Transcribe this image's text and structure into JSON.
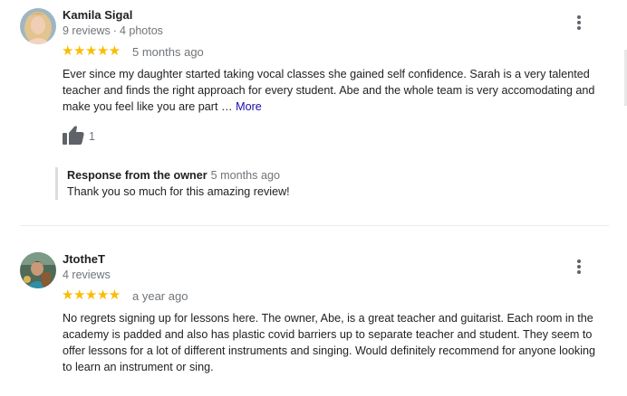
{
  "reviews": [
    {
      "author": "Kamila Sigal",
      "reviews_count": "9 reviews",
      "photos_count": "4 photos",
      "meta_separator": "·",
      "stars": "★★★★★",
      "rating": 5,
      "date": "5 months ago",
      "text": "Ever since my daughter started taking vocal classes she gained self confidence. Sarah is a very talented teacher and finds the right approach for every student. Abe and the whole team is very accomodating and make you feel like you are part …",
      "more_label": "More",
      "likes": "1",
      "owner_response": {
        "label": "Response from the owner",
        "date": "5 months ago",
        "text": "Thank you so much for this amazing review!"
      }
    },
    {
      "author": "JtotheT",
      "reviews_count": "4 reviews",
      "stars": "★★★★★",
      "rating": 5,
      "date": "a year ago",
      "text": "No regrets signing up for lessons here. The owner, Abe, is a great teacher and guitarist. Each room in the academy is padded and also has plastic covid barriers up to separate teacher and student. They seem to offer lessons for a lot of different instruments and singing. Would definitely recommend for anyone looking to learn an instrument or sing."
    }
  ],
  "icons": {
    "menu": "more-vert-icon",
    "like": "thumb-up-icon"
  },
  "colors": {
    "star": "#fbbc04",
    "link": "#1a0dab",
    "meta": "#70757a"
  }
}
